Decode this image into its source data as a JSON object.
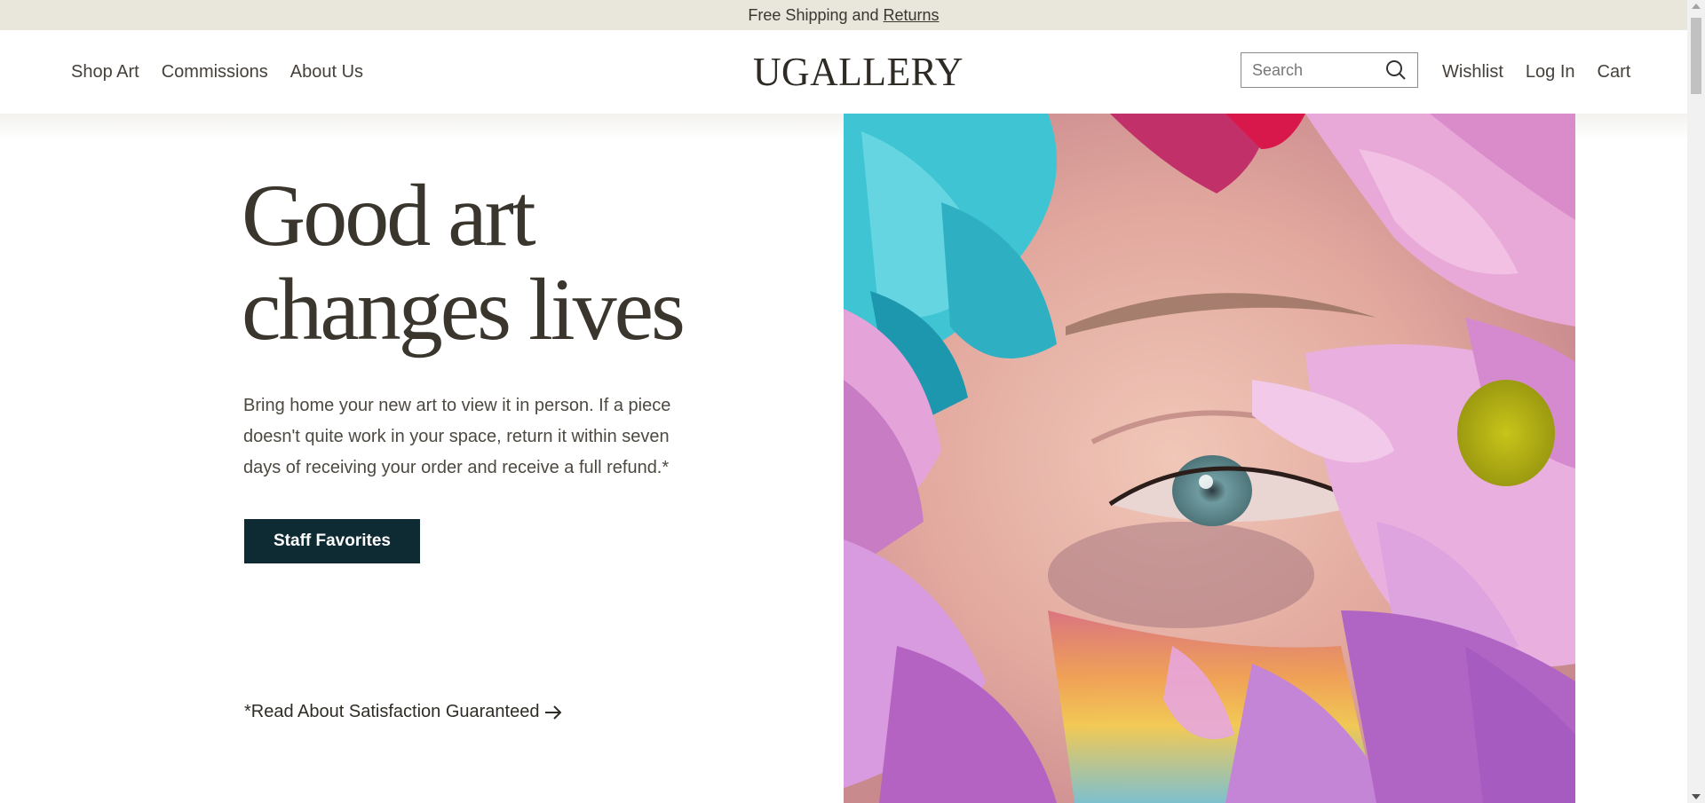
{
  "announcement": {
    "prefix": "Free Shipping and",
    "link": "Returns"
  },
  "nav_left": [
    {
      "label": "Shop Art"
    },
    {
      "label": "Commissions"
    },
    {
      "label": "About Us"
    }
  ],
  "logo": "UGALLERY",
  "search": {
    "placeholder": "Search",
    "icon": "search-icon"
  },
  "nav_right": [
    {
      "label": "Wishlist"
    },
    {
      "label": "Log In"
    },
    {
      "label": "Cart"
    }
  ],
  "hero": {
    "title_line1": "Good art",
    "title_line2": "changes lives",
    "body": "Bring home your new art to view it in person. If a piece doesn't quite work in your space, return it within seven days of receiving your order and receive a full refund.*",
    "cta_label": "Staff Favorites",
    "guarantee_link": "*Read About Satisfaction Guaranteed"
  },
  "colors": {
    "announcement_bg": "#e9e6dc",
    "cta_bg": "#0e2a33",
    "heading": "#3a362e"
  }
}
